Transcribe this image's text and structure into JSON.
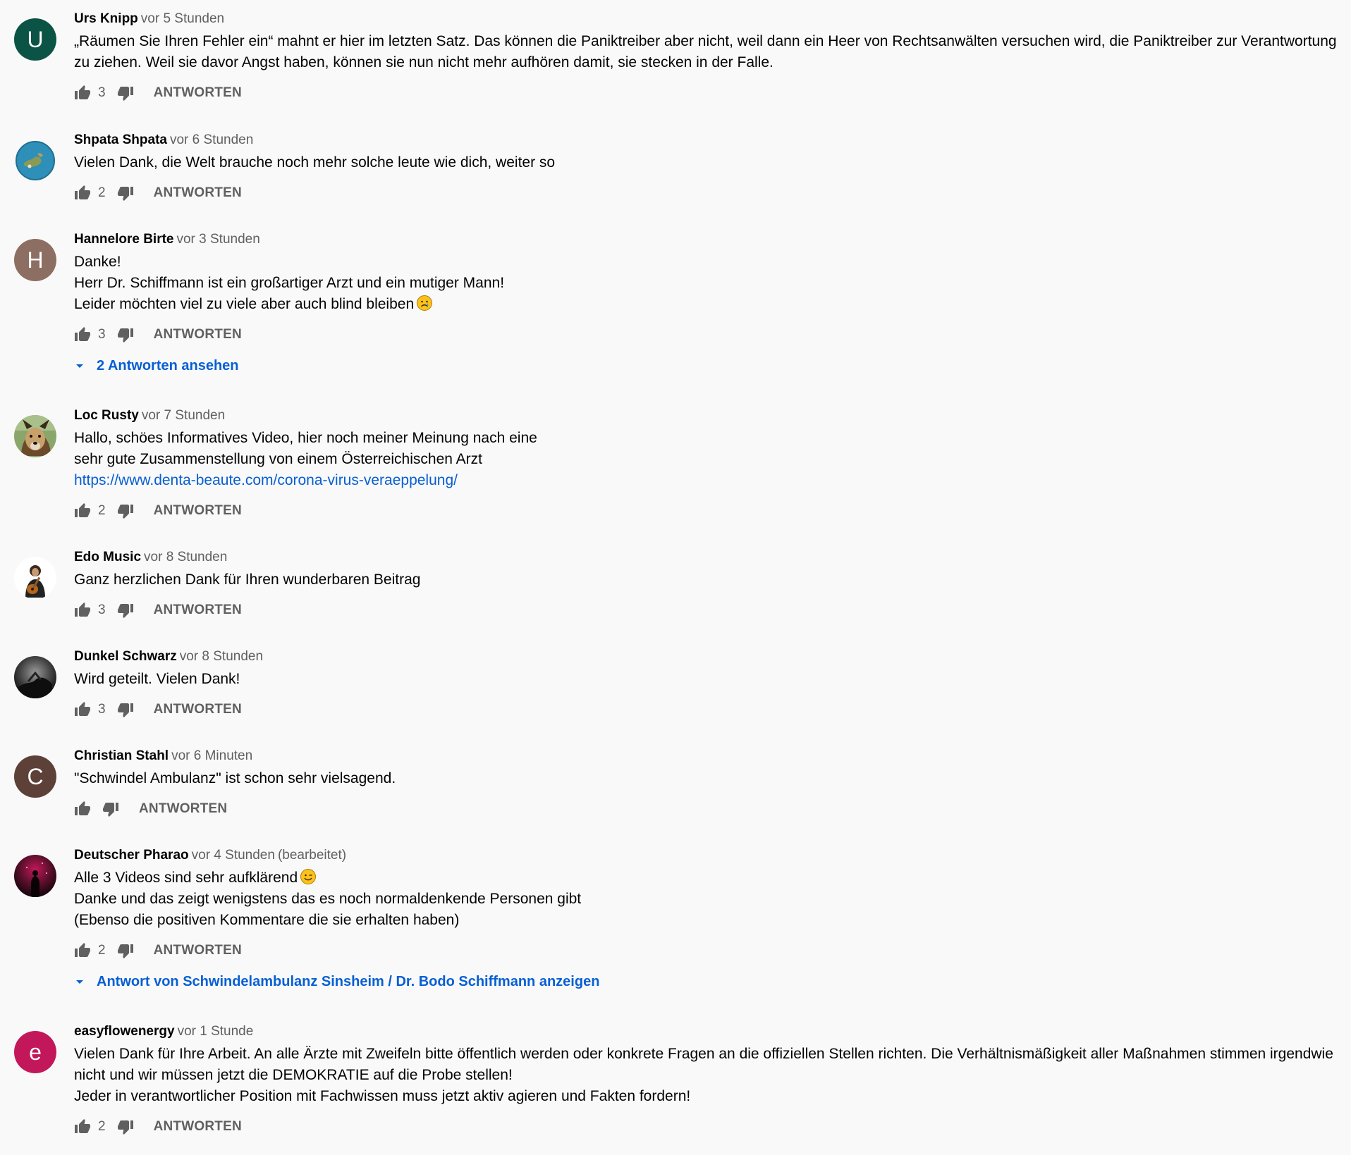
{
  "labels": {
    "reply": "ANTWORTEN"
  },
  "colors": {
    "link": "#065fd4",
    "muted": "#606060",
    "background": "#f9f9f9"
  },
  "comments": [
    {
      "author": "Urs Knipp",
      "time": "vor 5 Stunden",
      "avatar": {
        "letter": "U",
        "color": "#0b5345"
      },
      "lines": [
        "„Räumen Sie Ihren Fehler ein“ mahnt er hier im letzten Satz. Das können die Paniktreiber aber nicht, weil dann ein Heer von Rechtsanwälten versuchen wird, die Paniktreiber zur Verantwortung zu ziehen. Weil sie davor Angst haben, können sie nun nicht mehr aufhören damit, sie stecken in der Falle."
      ],
      "likes": "3"
    },
    {
      "author": "Shpata Shpata",
      "time": "vor 6 Stunden",
      "avatar": {
        "image": "globe-photo"
      },
      "lines": [
        "Vielen Dank, die Welt brauche noch mehr solche leute wie dich, weiter so"
      ],
      "likes": "2"
    },
    {
      "author": "Hannelore Birte",
      "time": "vor 3 Stunden",
      "avatar": {
        "letter": "H",
        "color": "#8d6e63"
      },
      "lines": [
        "Danke!",
        "Herr Dr. Schiffmann ist ein großartiger Arzt und ein mutiger Mann!",
        "Leider möchten viel zu viele aber auch blind bleiben"
      ],
      "emoji": "sad-face-emoji",
      "likes": "3",
      "replies_link": "2 Antworten ansehen"
    },
    {
      "author": "Loc Rusty",
      "time": "vor 7 Stunden",
      "avatar": {
        "image": "dog-photo"
      },
      "lines": [
        "Hallo, schöes Informatives Video, hier noch meiner Meinung nach eine",
        "sehr gute Zusammenstellung von einem Österreichischen Arzt"
      ],
      "link": "https://www.denta-beaute.com/corona-virus-veraeppelung/",
      "likes": "2"
    },
    {
      "author": "Edo Music",
      "time": "vor 8 Stunden",
      "avatar": {
        "image": "guitarist-photo"
      },
      "lines": [
        "Ganz herzlichen Dank für Ihren wunderbaren Beitrag"
      ],
      "likes": "3"
    },
    {
      "author": "Dunkel Schwarz",
      "time": "vor 8 Stunden",
      "avatar": {
        "image": "dark-photo"
      },
      "lines": [
        "Wird geteilt. Vielen Dank!"
      ],
      "likes": "3"
    },
    {
      "author": "Christian Stahl",
      "time": "vor 6 Minuten",
      "avatar": {
        "letter": "C",
        "color": "#5d4037"
      },
      "lines": [
        "\"Schwindel Ambulanz\" ist schon sehr vielsagend."
      ],
      "likes": ""
    },
    {
      "author": "Deutscher Pharao",
      "time": "vor 4 Stunden",
      "edited": "(bearbeitet)",
      "avatar": {
        "image": "red-night-photo"
      },
      "lines": [
        "Alle 3 Videos sind sehr aufklärend",
        "Danke und das zeigt wenigstens das es noch normaldenkende Personen gibt",
        "(Ebenso die positiven Kommentare die sie erhalten haben)"
      ],
      "emoji": "wink-face-emoji",
      "likes": "2",
      "replies_link": "Antwort von Schwindelambulanz Sinsheim / Dr. Bodo Schiffmann anzeigen"
    },
    {
      "author": "easyflowenergy",
      "time": "vor 1 Stunde",
      "avatar": {
        "letter": "e",
        "color": "#c2185b"
      },
      "lines": [
        "Vielen Dank für Ihre Arbeit. An alle Ärzte mit Zweifeln bitte öffentlich werden oder konkrete Fragen an die offiziellen Stellen richten. Die Verhältnismäßigkeit aller Maßnahmen stimmen irgendwie nicht und wir müssen jetzt die DEMOKRATIE auf die Probe stellen!",
        "Jeder in verantwortlicher Position mit Fachwissen muss jetzt aktiv agieren und Fakten fordern!"
      ],
      "likes": "2"
    }
  ]
}
